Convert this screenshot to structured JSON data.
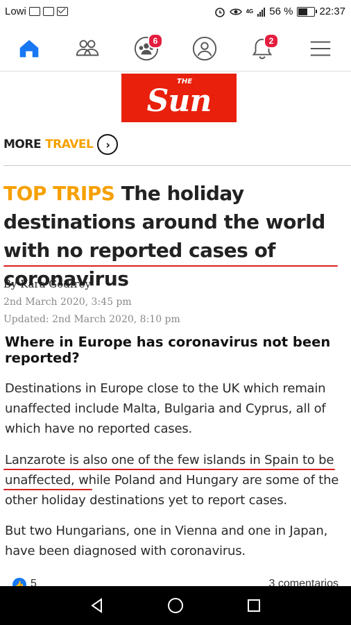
{
  "status_bar": {
    "carrier": "Lowi",
    "network": "4G",
    "battery_percent": "56 %",
    "battery_level": 0.56,
    "time": "22:37"
  },
  "tab_bar": {
    "tabs": [
      {
        "name": "home",
        "icon": "home-icon",
        "active": true,
        "badge": ""
      },
      {
        "name": "friends",
        "icon": "friends-icon",
        "active": false,
        "badge": ""
      },
      {
        "name": "groups",
        "icon": "groups-icon",
        "active": false,
        "badge": "6"
      },
      {
        "name": "profile",
        "icon": "profile-icon",
        "active": false,
        "badge": ""
      },
      {
        "name": "notifications",
        "icon": "bell-icon",
        "active": false,
        "badge": "2"
      },
      {
        "name": "menu",
        "icon": "hamburger-icon",
        "active": false,
        "badge": ""
      }
    ],
    "accent_color": "#1877f2",
    "badge_color": "#e41e3f"
  },
  "article": {
    "logo_small": "THE",
    "logo_main": "Sun",
    "logo_color": "#e8200c",
    "section_prefix": "MORE",
    "section_name": "TRAVEL",
    "section_color": "#f6a000",
    "kicker": "TOP TRIPS",
    "headline": "The holiday destinations around the world with no reported cases of coronavirus",
    "author": "By Kara Godfrey",
    "published": "2nd March 2020, 3:45 pm",
    "updated": "Updated: 2nd March 2020, 8:10 pm",
    "subheading": "Where in Europe has coronavirus not been reported?",
    "paragraph_1": "Destinations in Europe close to the UK which remain unaffected include Malta, Bulgaria and Cyprus, all of which have no reported cases.",
    "paragraph_2": "Lanzarote is also one of the few islands in Spain to be unaffected, while Poland and Hungary are some of the other holiday destinations yet to report cases.",
    "paragraph_3": "But two Hungarians, one in Vienna and one in Japan, have been diagnosed with coronavirus.",
    "underline_color": "#d7221c"
  },
  "reactions": {
    "like_count": "5",
    "comments": "3 comentarios"
  },
  "nav_bar": {
    "buttons": [
      "back-icon",
      "home-circle-icon",
      "recents-icon"
    ]
  }
}
